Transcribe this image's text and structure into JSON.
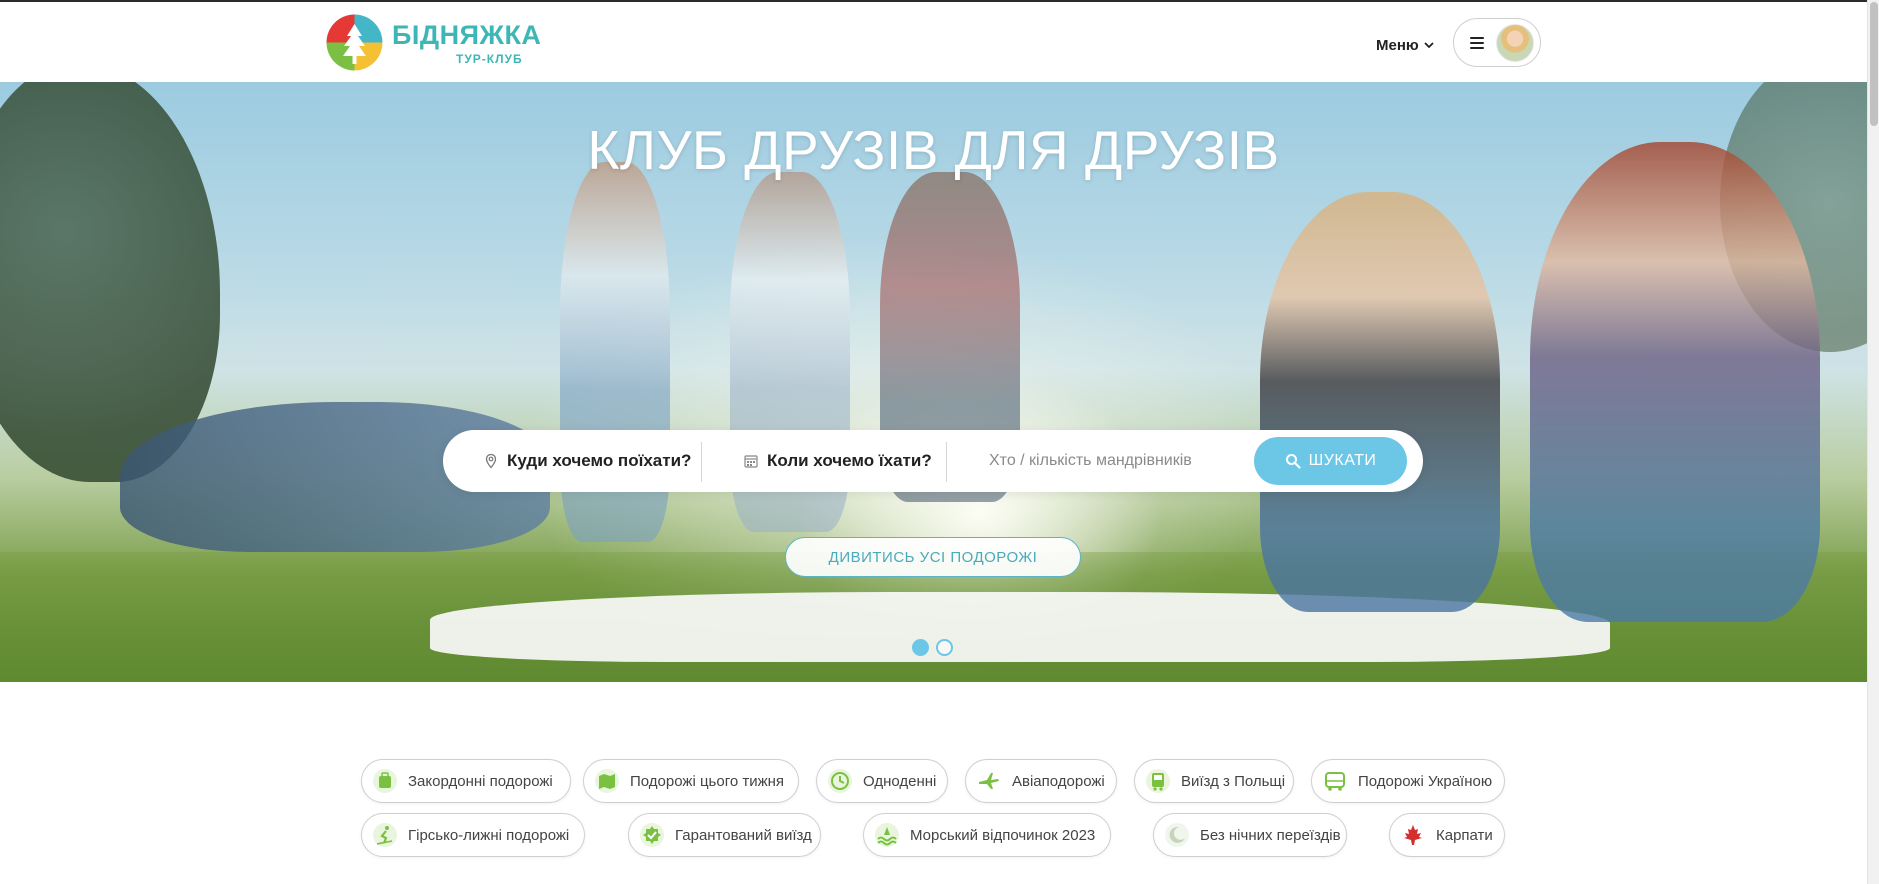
{
  "brand": {
    "name": "БІДНЯЖКА",
    "subtitle": "ТУР-КЛУБ"
  },
  "header": {
    "menu_label": "Меню"
  },
  "hero": {
    "title": "КЛУБ ДРУЗІВ ДЛЯ ДРУЗІВ",
    "slides_total": 2,
    "active_slide": 1
  },
  "search": {
    "where_label": "Куди хочемо поїхати?",
    "when_label": "Коли хочемо їхати?",
    "who_placeholder": "Хто / кількість мандрівників",
    "button_label": "ШУКАТИ"
  },
  "all_trips_label": "ДИВИТИСЬ УСІ ПОДОРОЖІ",
  "categories": [
    {
      "label": "Закордонні подорожі",
      "icon": "globe-luggage-icon"
    },
    {
      "label": "Подорожі цього тижня",
      "icon": "map-calendar-icon"
    },
    {
      "label": "Одноденні",
      "icon": "one-day-clock-icon"
    },
    {
      "label": "Авіаподорожі",
      "icon": "airplane-icon"
    },
    {
      "label": "Виїзд з Польщі",
      "icon": "bus-poland-icon"
    },
    {
      "label": "Подорожі Україною",
      "icon": "bus-icon"
    },
    {
      "label": "Гірсько-лижні подорожі",
      "icon": "skier-icon"
    },
    {
      "label": "Гарантований виїзд",
      "icon": "guaranteed-badge-icon"
    },
    {
      "label": "Морський відпочинок 2023",
      "icon": "sea-wave-icon"
    },
    {
      "label": "Без нічних переїздів",
      "icon": "moon-icon"
    },
    {
      "label": "Карпати",
      "icon": "maple-leaf-icon"
    }
  ],
  "colors": {
    "accent": "#6cc6e6",
    "brand_teal": "#3fb6b6",
    "category_icon_green": "#7ac142",
    "maple_red": "#d32f2f"
  }
}
